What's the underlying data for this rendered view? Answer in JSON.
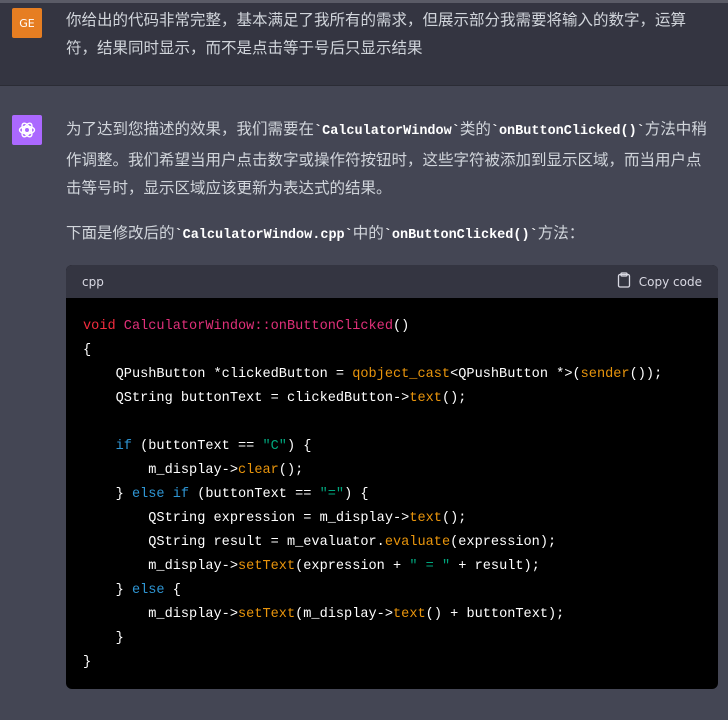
{
  "user": {
    "avatar": "GE",
    "message": "你给出的代码非常完整，基本满足了我所有的需求，但展示部分我需要将输入的数字，运算符，结果同时显示，而不是点击等于号后只显示结果"
  },
  "assistant": {
    "avatar_icon": "openai-logo-icon",
    "paragraph1": [
      "为了达到您描述的效果，我们需要在",
      "`CalculatorWindow`",
      "类的",
      "`onButtonClicked()`",
      "方法中稍作调整。我们希望当用户点击数字或操作符按钮时，这些字符被添加到显示区域，而当用户点击等号时，显示区域应该更新为表达式的结果。"
    ],
    "paragraph2": [
      "下面是修改后的",
      "`CalculatorWindow.cpp`",
      "中的",
      "`onButtonClicked()`",
      "方法："
    ],
    "code_block": {
      "language": "cpp",
      "copy_label": "Copy code",
      "lines": [
        [
          [
            "ty",
            "void "
          ],
          [
            "fn",
            "CalculatorWindow::onButtonClicked"
          ],
          [
            "",
            "()"
          ]
        ],
        [
          [
            "",
            "{"
          ]
        ],
        [
          [
            "",
            "    QPushButton *clickedButton = "
          ],
          [
            "call",
            "qobject_cast"
          ],
          [
            "",
            "<QPushButton *>("
          ],
          [
            "call",
            "sender"
          ],
          [
            "",
            "());"
          ]
        ],
        [
          [
            "",
            "    QString buttonText = clickedButton->"
          ],
          [
            "call",
            "text"
          ],
          [
            "",
            "();"
          ]
        ],
        [
          [
            "",
            ""
          ]
        ],
        [
          [
            "kw",
            "    if"
          ],
          [
            "",
            " (buttonText == "
          ],
          [
            "str",
            "\"C\""
          ],
          [
            "",
            ") {"
          ]
        ],
        [
          [
            "",
            "        m_display->"
          ],
          [
            "call",
            "clear"
          ],
          [
            "",
            "();"
          ]
        ],
        [
          [
            "",
            "    } "
          ],
          [
            "kw",
            "else if"
          ],
          [
            "",
            " (buttonText == "
          ],
          [
            "str",
            "\"=\""
          ],
          [
            "",
            ") {"
          ]
        ],
        [
          [
            "",
            "        QString expression = m_display->"
          ],
          [
            "call",
            "text"
          ],
          [
            "",
            "();"
          ]
        ],
        [
          [
            "",
            "        QString result = m_evaluator."
          ],
          [
            "call",
            "evaluate"
          ],
          [
            "",
            "(expression);"
          ]
        ],
        [
          [
            "",
            "        m_display->"
          ],
          [
            "call",
            "setText"
          ],
          [
            "",
            "(expression + "
          ],
          [
            "str",
            "\" = \""
          ],
          [
            "",
            " + result);"
          ]
        ],
        [
          [
            "",
            "    } "
          ],
          [
            "kw",
            "else"
          ],
          [
            "",
            " {"
          ]
        ],
        [
          [
            "",
            "        m_display->"
          ],
          [
            "call",
            "setText"
          ],
          [
            "",
            "(m_display->"
          ],
          [
            "call",
            "text"
          ],
          [
            "",
            "() + buttonText);"
          ]
        ],
        [
          [
            "",
            "    }"
          ]
        ],
        [
          [
            "",
            "}"
          ]
        ]
      ]
    }
  }
}
